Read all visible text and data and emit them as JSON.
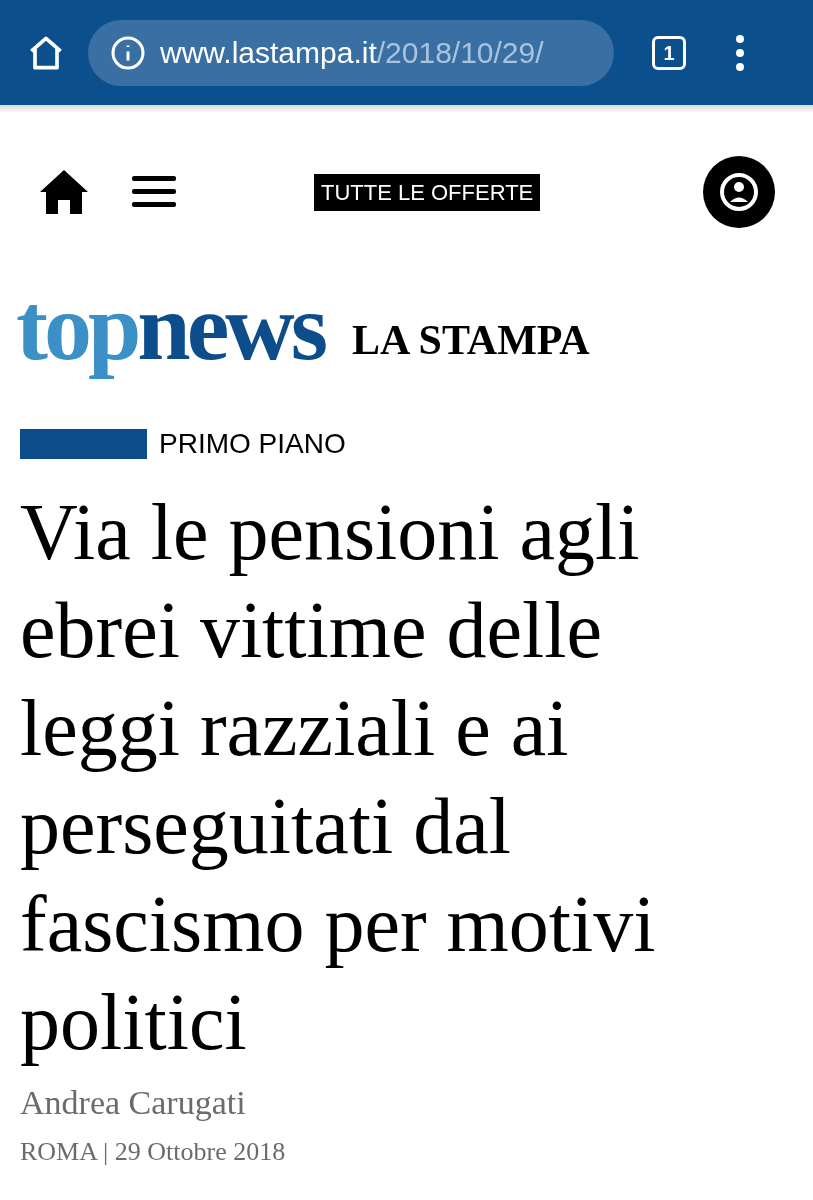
{
  "browser": {
    "url_host": "www.lastampa.it",
    "url_path": "/2018/10/29/",
    "tab_count": "1"
  },
  "header": {
    "offers_label": "TUTTE LE OFFERTE"
  },
  "logo": {
    "part_1": "top",
    "part_2": "news",
    "brand": "LA STAMPA"
  },
  "section": {
    "label": "PRIMO PIANO"
  },
  "headline": {
    "lines": [
      "Via le pensioni agli",
      "ebrei vittime delle",
      "leggi razziali e ai",
      "perseguitati dal",
      "fascismo per motivi",
      "politici"
    ]
  },
  "author": "Andrea Carugati",
  "dateline": {
    "place": "ROMA",
    "separator": "|",
    "date": "29 Ottobre 2018"
  }
}
